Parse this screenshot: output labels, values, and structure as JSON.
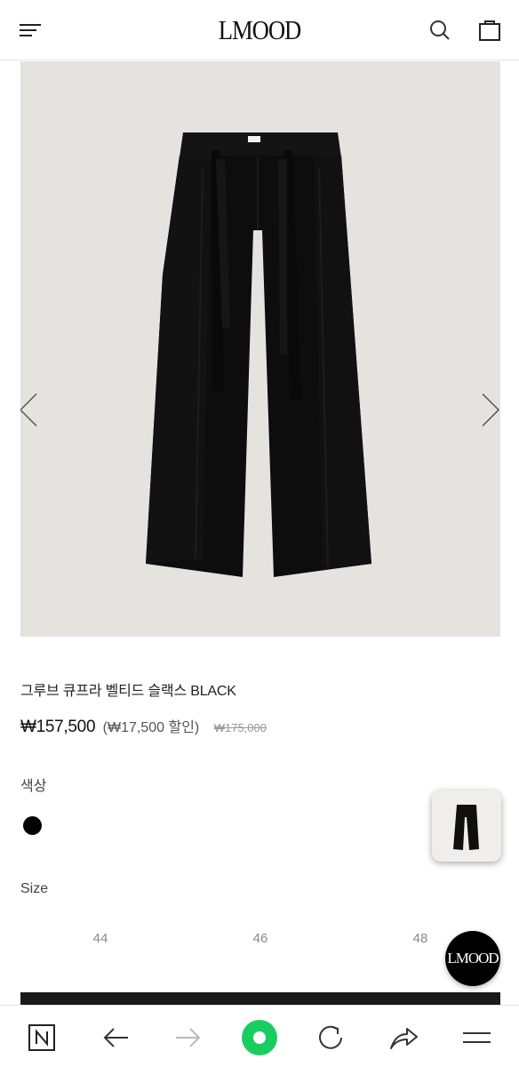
{
  "header": {
    "logo": "LMOOD",
    "menu_icon": "hamburger-menu-icon",
    "search_icon": "search-icon",
    "bag_icon": "shopping-bag-icon"
  },
  "gallery": {
    "image": "black belted slacks product photo",
    "prev_icon": "chevron-left-icon",
    "next_icon": "chevron-right-icon",
    "background_color": "#e4e3e0"
  },
  "product": {
    "name": "그루브 큐프라 벨티드 슬랙스 BLACK",
    "price": "₩157,500",
    "discount": "(₩17,500 할인)",
    "original_price": "₩175,000"
  },
  "options": {
    "color_label": "색상",
    "colors": [
      {
        "value": "#000000"
      }
    ],
    "size_label": "Size",
    "sizes": [
      "44",
      "46",
      "48"
    ]
  },
  "floating": {
    "fab_label": "LMOOD"
  },
  "browser": {
    "accent": "#19ce60",
    "buttons": [
      "naver-home-icon",
      "back-arrow-icon",
      "forward-arrow-icon",
      "green-dot-icon",
      "refresh-icon",
      "share-icon",
      "menu-icon"
    ]
  }
}
